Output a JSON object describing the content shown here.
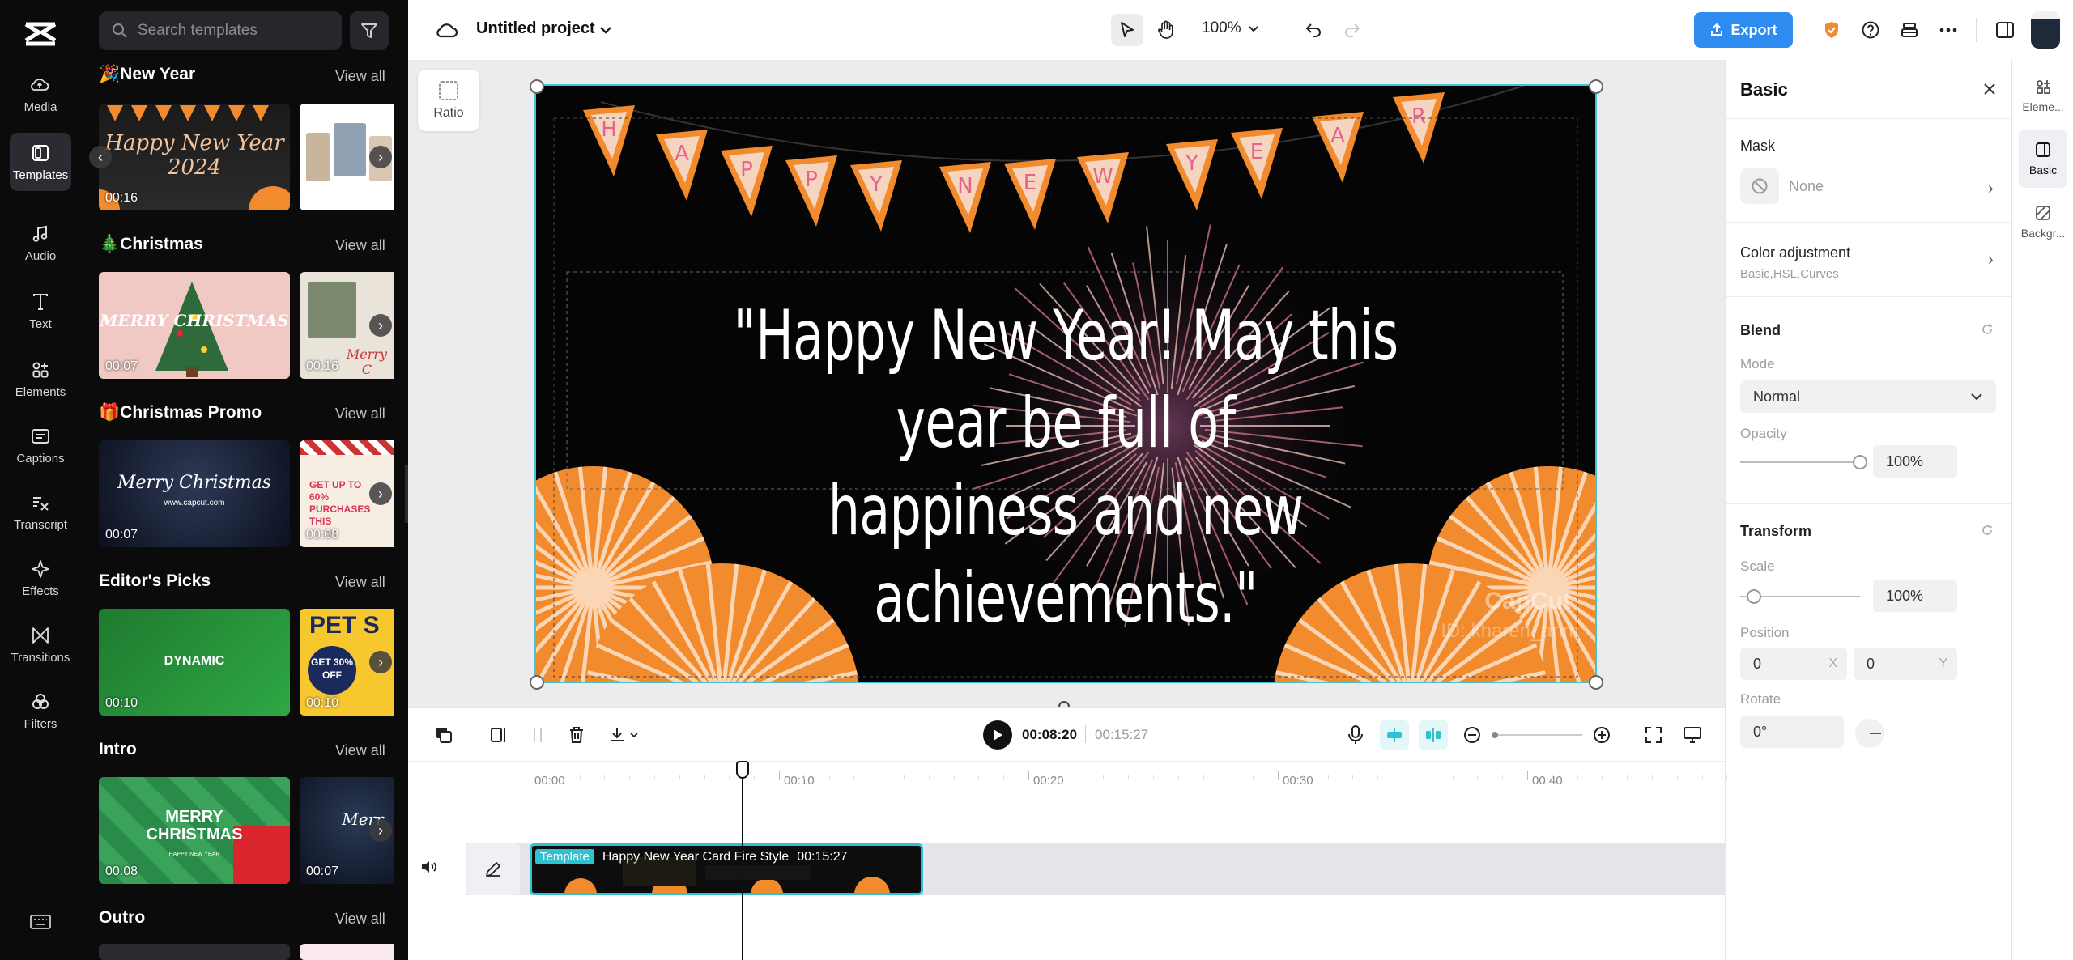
{
  "nav": {
    "items": [
      {
        "label": "Media",
        "icon": "cloud-upload-icon"
      },
      {
        "label": "Templates",
        "icon": "templates-icon",
        "active": true
      },
      {
        "label": "Audio",
        "icon": "music-note-icon"
      },
      {
        "label": "Text",
        "icon": "text-t-icon"
      },
      {
        "label": "Elements",
        "icon": "elements-icon"
      },
      {
        "label": "Captions",
        "icon": "captions-icon"
      },
      {
        "label": "Transcript",
        "icon": "transcript-icon"
      },
      {
        "label": "Effects",
        "icon": "sparkle-icon"
      },
      {
        "label": "Transitions",
        "icon": "transitions-icon"
      },
      {
        "label": "Filters",
        "icon": "filters-icon"
      }
    ]
  },
  "templates": {
    "search_placeholder": "Search templates",
    "view_all": "View all",
    "sections": [
      {
        "title": "🎉New Year",
        "d1": "00:16",
        "t1": "Happy New Year 2024",
        "d2": ""
      },
      {
        "title": "🎄Christmas",
        "d1": "00:07",
        "t1": "MERRY CHRISTMAS",
        "d2": "00:16",
        "t2": "Merry C"
      },
      {
        "title": "🎁Christmas Promo",
        "d1": "00:07",
        "t1": "Merry Christmas",
        "s1": "www.capcut.com",
        "d2": "00:08",
        "t2": "GET UP TO 60% PURCHASES THIS"
      },
      {
        "title": "Editor's Picks",
        "d1": "00:10",
        "t1": "DYNAMIC",
        "d2": "00:10",
        "t2": "PET S",
        "t2b": "GET 30% OFF"
      },
      {
        "title": "Intro",
        "d1": "00:08",
        "t1": "MERRY CHRISTMAS",
        "s1": "HAPPY NEW YEAR",
        "d2": "00:07",
        "t2": "Merr"
      },
      {
        "title": "Outro"
      }
    ]
  },
  "topbar": {
    "project_name": "Untitled project",
    "zoom": "100%",
    "export_label": "Export"
  },
  "stage": {
    "ratio_label": "Ratio",
    "banner_letters": [
      "H",
      "A",
      "P",
      "P",
      "Y",
      "N",
      "E",
      "W",
      "Y",
      "E",
      "A",
      "R"
    ],
    "quote_line1": "\"Happy New Year! May this year be full of",
    "quote_line2": "happiness and new achievements.\"",
    "watermark": "CapCut",
    "watermark_id": "ID: kharen_anm"
  },
  "properties": {
    "title": "Basic",
    "mask_label": "Mask",
    "mask_value": "None",
    "color_adj_label": "Color adjustment",
    "color_adj_sub": "Basic,HSL,Curves",
    "blend_label": "Blend",
    "mode_label": "Mode",
    "mode_value": "Normal",
    "opacity_label": "Opacity",
    "opacity_value": "100%",
    "opacity_fraction": 1.0,
    "transform_label": "Transform",
    "scale_label": "Scale",
    "scale_value": "100%",
    "position_label": "Position",
    "pos_x": "0",
    "pos_x_axis": "X",
    "pos_y": "0",
    "pos_y_axis": "Y",
    "rotate_label": "Rotate",
    "rotate_value": "0°"
  },
  "side_tabs": [
    {
      "label": "Eleme...",
      "icon": "elements-panel-icon"
    },
    {
      "label": "Basic",
      "icon": "basic-panel-icon",
      "active": true
    },
    {
      "label": "Backgr...",
      "icon": "background-panel-icon"
    }
  ],
  "timeline": {
    "current_time": "00:08:20",
    "total_time": "00:15:27",
    "ruler": [
      "00:00",
      "00:10",
      "00:20",
      "00:30",
      "00:40"
    ],
    "clip_tag": "Template",
    "clip_name": "Happy New Year Card Fire Style",
    "clip_duration": "00:15:27"
  },
  "colors": {
    "accent": "#2e8cf0",
    "selection": "#46c2d0",
    "orange": "#f28a2e"
  }
}
